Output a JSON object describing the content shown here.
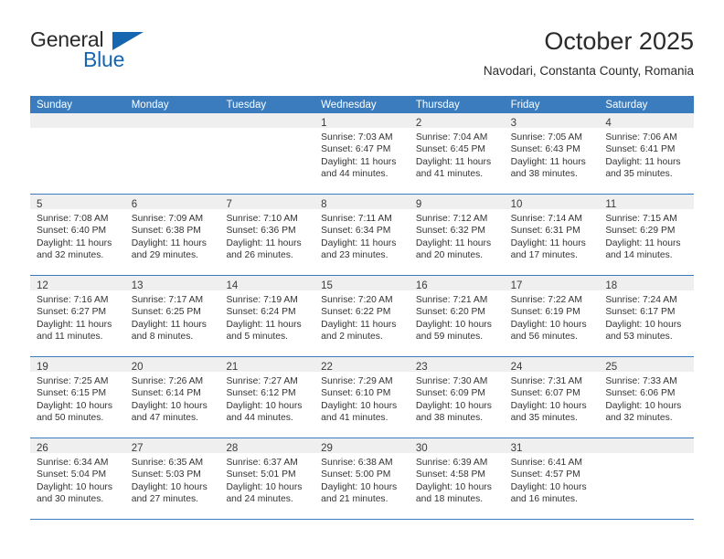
{
  "brand": {
    "name_part1": "General",
    "name_part2": "Blue",
    "triangle_icon": "triangle-icon",
    "accent_color": "#1565b0"
  },
  "header": {
    "title": "October 2025",
    "subtitle": "Navodari, Constanta County, Romania"
  },
  "calendar": {
    "header_bg": "#3a7cbe",
    "daynum_bg": "#efefef",
    "weekday_headers": [
      "Sunday",
      "Monday",
      "Tuesday",
      "Wednesday",
      "Thursday",
      "Friday",
      "Saturday"
    ],
    "labels": {
      "sunrise": "Sunrise:",
      "sunset": "Sunset:",
      "daylight": "Daylight:"
    },
    "weeks": [
      [
        {
          "day": "",
          "lines": []
        },
        {
          "day": "",
          "lines": []
        },
        {
          "day": "",
          "lines": []
        },
        {
          "day": "1",
          "lines": [
            "Sunrise: 7:03 AM",
            "Sunset: 6:47 PM",
            "Daylight: 11 hours",
            "and 44 minutes."
          ]
        },
        {
          "day": "2",
          "lines": [
            "Sunrise: 7:04 AM",
            "Sunset: 6:45 PM",
            "Daylight: 11 hours",
            "and 41 minutes."
          ]
        },
        {
          "day": "3",
          "lines": [
            "Sunrise: 7:05 AM",
            "Sunset: 6:43 PM",
            "Daylight: 11 hours",
            "and 38 minutes."
          ]
        },
        {
          "day": "4",
          "lines": [
            "Sunrise: 7:06 AM",
            "Sunset: 6:41 PM",
            "Daylight: 11 hours",
            "and 35 minutes."
          ]
        }
      ],
      [
        {
          "day": "5",
          "lines": [
            "Sunrise: 7:08 AM",
            "Sunset: 6:40 PM",
            "Daylight: 11 hours",
            "and 32 minutes."
          ]
        },
        {
          "day": "6",
          "lines": [
            "Sunrise: 7:09 AM",
            "Sunset: 6:38 PM",
            "Daylight: 11 hours",
            "and 29 minutes."
          ]
        },
        {
          "day": "7",
          "lines": [
            "Sunrise: 7:10 AM",
            "Sunset: 6:36 PM",
            "Daylight: 11 hours",
            "and 26 minutes."
          ]
        },
        {
          "day": "8",
          "lines": [
            "Sunrise: 7:11 AM",
            "Sunset: 6:34 PM",
            "Daylight: 11 hours",
            "and 23 minutes."
          ]
        },
        {
          "day": "9",
          "lines": [
            "Sunrise: 7:12 AM",
            "Sunset: 6:32 PM",
            "Daylight: 11 hours",
            "and 20 minutes."
          ]
        },
        {
          "day": "10",
          "lines": [
            "Sunrise: 7:14 AM",
            "Sunset: 6:31 PM",
            "Daylight: 11 hours",
            "and 17 minutes."
          ]
        },
        {
          "day": "11",
          "lines": [
            "Sunrise: 7:15 AM",
            "Sunset: 6:29 PM",
            "Daylight: 11 hours",
            "and 14 minutes."
          ]
        }
      ],
      [
        {
          "day": "12",
          "lines": [
            "Sunrise: 7:16 AM",
            "Sunset: 6:27 PM",
            "Daylight: 11 hours",
            "and 11 minutes."
          ]
        },
        {
          "day": "13",
          "lines": [
            "Sunrise: 7:17 AM",
            "Sunset: 6:25 PM",
            "Daylight: 11 hours",
            "and 8 minutes."
          ]
        },
        {
          "day": "14",
          "lines": [
            "Sunrise: 7:19 AM",
            "Sunset: 6:24 PM",
            "Daylight: 11 hours",
            "and 5 minutes."
          ]
        },
        {
          "day": "15",
          "lines": [
            "Sunrise: 7:20 AM",
            "Sunset: 6:22 PM",
            "Daylight: 11 hours",
            "and 2 minutes."
          ]
        },
        {
          "day": "16",
          "lines": [
            "Sunrise: 7:21 AM",
            "Sunset: 6:20 PM",
            "Daylight: 10 hours",
            "and 59 minutes."
          ]
        },
        {
          "day": "17",
          "lines": [
            "Sunrise: 7:22 AM",
            "Sunset: 6:19 PM",
            "Daylight: 10 hours",
            "and 56 minutes."
          ]
        },
        {
          "day": "18",
          "lines": [
            "Sunrise: 7:24 AM",
            "Sunset: 6:17 PM",
            "Daylight: 10 hours",
            "and 53 minutes."
          ]
        }
      ],
      [
        {
          "day": "19",
          "lines": [
            "Sunrise: 7:25 AM",
            "Sunset: 6:15 PM",
            "Daylight: 10 hours",
            "and 50 minutes."
          ]
        },
        {
          "day": "20",
          "lines": [
            "Sunrise: 7:26 AM",
            "Sunset: 6:14 PM",
            "Daylight: 10 hours",
            "and 47 minutes."
          ]
        },
        {
          "day": "21",
          "lines": [
            "Sunrise: 7:27 AM",
            "Sunset: 6:12 PM",
            "Daylight: 10 hours",
            "and 44 minutes."
          ]
        },
        {
          "day": "22",
          "lines": [
            "Sunrise: 7:29 AM",
            "Sunset: 6:10 PM",
            "Daylight: 10 hours",
            "and 41 minutes."
          ]
        },
        {
          "day": "23",
          "lines": [
            "Sunrise: 7:30 AM",
            "Sunset: 6:09 PM",
            "Daylight: 10 hours",
            "and 38 minutes."
          ]
        },
        {
          "day": "24",
          "lines": [
            "Sunrise: 7:31 AM",
            "Sunset: 6:07 PM",
            "Daylight: 10 hours",
            "and 35 minutes."
          ]
        },
        {
          "day": "25",
          "lines": [
            "Sunrise: 7:33 AM",
            "Sunset: 6:06 PM",
            "Daylight: 10 hours",
            "and 32 minutes."
          ]
        }
      ],
      [
        {
          "day": "26",
          "lines": [
            "Sunrise: 6:34 AM",
            "Sunset: 5:04 PM",
            "Daylight: 10 hours",
            "and 30 minutes."
          ]
        },
        {
          "day": "27",
          "lines": [
            "Sunrise: 6:35 AM",
            "Sunset: 5:03 PM",
            "Daylight: 10 hours",
            "and 27 minutes."
          ]
        },
        {
          "day": "28",
          "lines": [
            "Sunrise: 6:37 AM",
            "Sunset: 5:01 PM",
            "Daylight: 10 hours",
            "and 24 minutes."
          ]
        },
        {
          "day": "29",
          "lines": [
            "Sunrise: 6:38 AM",
            "Sunset: 5:00 PM",
            "Daylight: 10 hours",
            "and 21 minutes."
          ]
        },
        {
          "day": "30",
          "lines": [
            "Sunrise: 6:39 AM",
            "Sunset: 4:58 PM",
            "Daylight: 10 hours",
            "and 18 minutes."
          ]
        },
        {
          "day": "31",
          "lines": [
            "Sunrise: 6:41 AM",
            "Sunset: 4:57 PM",
            "Daylight: 10 hours",
            "and 16 minutes."
          ]
        },
        {
          "day": "",
          "lines": []
        }
      ]
    ]
  }
}
